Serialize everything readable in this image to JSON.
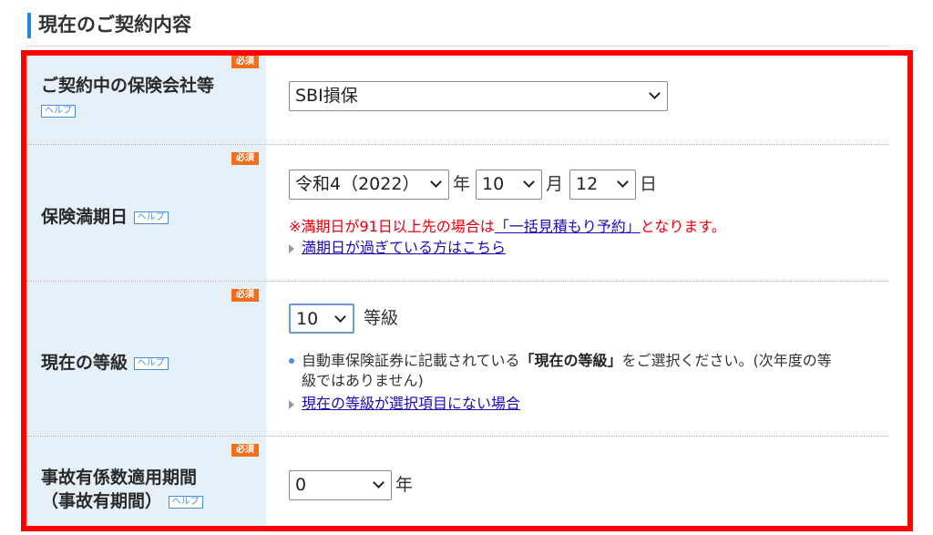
{
  "section": {
    "title": "現在のご契約内容"
  },
  "badges": {
    "required": "必須",
    "help": "ヘルプ"
  },
  "rows": {
    "insurer": {
      "label": "ご契約中の保険会社等",
      "selected": "SBI損保"
    },
    "expiry": {
      "label": "保険満期日",
      "year_value": "令和4（2022）",
      "year_unit": "年",
      "month_value": "10",
      "month_unit": "月",
      "day_value": "12",
      "day_unit": "日",
      "warning_prefix": "※満期日が91日以上先の場合は",
      "warning_link": "「一括見積もり予約」",
      "warning_suffix": "となります。",
      "expired_link": "満期日が過ぎている方はこちら"
    },
    "grade": {
      "label": "現在の等級",
      "value": "10",
      "unit": "等級",
      "note_prefix": "自動車保険証券に記載されている",
      "note_bold": "「現在の等級」",
      "note_suffix": "をご選択ください。(次年度の等",
      "note_line2": "級ではありません)",
      "missing_link": "現在の等級が選択項目にない場合"
    },
    "accident": {
      "label_line1": "事故有係数適用期間",
      "label_line2": "（事故有期間）",
      "value": "0",
      "unit": "年"
    }
  }
}
